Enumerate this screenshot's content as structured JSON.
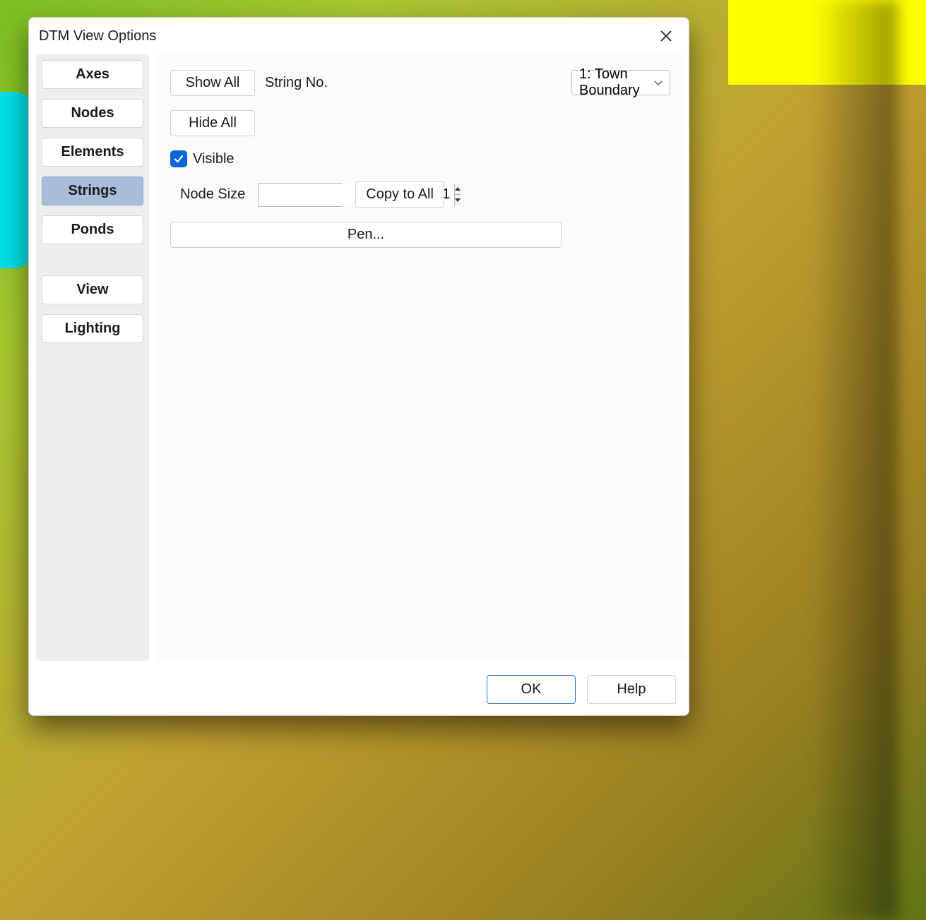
{
  "dialog": {
    "title": "DTM View Options"
  },
  "sidebar": {
    "group1": [
      {
        "key": "axes",
        "label": "Axes",
        "active": false
      },
      {
        "key": "nodes",
        "label": "Nodes",
        "active": false
      },
      {
        "key": "elements",
        "label": "Elements",
        "active": false
      },
      {
        "key": "strings",
        "label": "Strings",
        "active": true
      },
      {
        "key": "ponds",
        "label": "Ponds",
        "active": false
      }
    ],
    "group2": [
      {
        "key": "view",
        "label": "View",
        "active": false
      },
      {
        "key": "lighting",
        "label": "Lighting",
        "active": false
      }
    ]
  },
  "strings_panel": {
    "string_no_label": "String No.",
    "string_no_value": "1: Town Boundary",
    "visible_label": "Visible",
    "visible_checked": true,
    "node_size_label": "Node Size",
    "node_size_value": "1",
    "copy_to_all_label": "Copy to All",
    "pen_label": "Pen...",
    "show_all_label": "Show All",
    "hide_all_label": "Hide All"
  },
  "footer": {
    "ok_label": "OK",
    "help_label": "Help"
  }
}
